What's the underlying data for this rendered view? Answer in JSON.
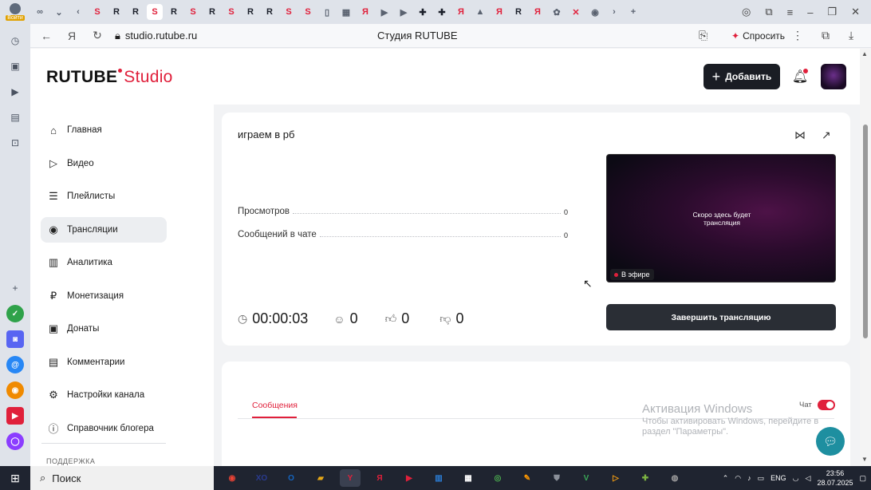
{
  "browser": {
    "profile_label": "Войти",
    "tabs": [
      {
        "glyph": "∞",
        "kind": "grey"
      },
      {
        "glyph": "⌄",
        "kind": "grey"
      },
      {
        "glyph": "‹",
        "kind": "grey"
      },
      {
        "glyph": "S",
        "kind": "s"
      },
      {
        "glyph": "R",
        "kind": "r"
      },
      {
        "glyph": "R",
        "kind": "r"
      },
      {
        "glyph": "S",
        "kind": "s",
        "active": true
      },
      {
        "glyph": "R",
        "kind": "r"
      },
      {
        "glyph": "S",
        "kind": "s"
      },
      {
        "glyph": "R",
        "kind": "r"
      },
      {
        "glyph": "S",
        "kind": "s"
      },
      {
        "glyph": "R",
        "kind": "r"
      },
      {
        "glyph": "R",
        "kind": "r"
      },
      {
        "glyph": "S",
        "kind": "s"
      },
      {
        "glyph": "S",
        "kind": "s"
      },
      {
        "glyph": "▯",
        "kind": "grey"
      },
      {
        "glyph": "▦",
        "kind": "grey"
      },
      {
        "glyph": "Я",
        "kind": "y"
      },
      {
        "glyph": "▶",
        "kind": "grey"
      },
      {
        "glyph": "▶",
        "kind": "grey"
      },
      {
        "glyph": "✚",
        "kind": "r"
      },
      {
        "glyph": "✚",
        "kind": "r"
      },
      {
        "glyph": "Я",
        "kind": "y"
      },
      {
        "glyph": "▲",
        "kind": "grey"
      },
      {
        "glyph": "Я",
        "kind": "y"
      },
      {
        "glyph": "R",
        "kind": "r"
      },
      {
        "glyph": "Я",
        "kind": "y"
      },
      {
        "glyph": "✿",
        "kind": "grey"
      },
      {
        "glyph": "✕",
        "kind": "y"
      },
      {
        "glyph": "◉",
        "kind": "grey"
      },
      {
        "glyph": "›",
        "kind": "grey"
      },
      {
        "glyph": "+",
        "kind": "grey"
      }
    ],
    "url": "studio.rutube.ru",
    "page_title": "Студия RUTUBE",
    "ask_label": "Спросить"
  },
  "studio": {
    "logo_main": "RUTUBE",
    "logo_accent": "Studio",
    "add_label": "Добавить",
    "nav": [
      {
        "id": "home",
        "label": "Главная",
        "icon": "⌂"
      },
      {
        "id": "video",
        "label": "Видео",
        "icon": "▷"
      },
      {
        "id": "playlists",
        "label": "Плейлисты",
        "icon": "☰"
      },
      {
        "id": "streams",
        "label": "Трансляции",
        "icon": "◉",
        "active": true
      },
      {
        "id": "analytics",
        "label": "Аналитика",
        "icon": "▥"
      },
      {
        "id": "monetization",
        "label": "Монетизация",
        "icon": "₽"
      },
      {
        "id": "donations",
        "label": "Донаты",
        "icon": "▣"
      },
      {
        "id": "comments",
        "label": "Комментарии",
        "icon": "▤"
      },
      {
        "id": "channel-settings",
        "label": "Настройки канала",
        "icon": "⚙"
      },
      {
        "id": "blogger-guide",
        "label": "Справочник блогера",
        "icon": "ⓘ"
      }
    ],
    "support_label": "ПОДДЕРЖКА"
  },
  "stream": {
    "title": "играем в рб",
    "stats": [
      {
        "label": "Просмотров",
        "value": "0"
      },
      {
        "label": "Сообщений в чате",
        "value": "0"
      }
    ],
    "preview_text_1": "Скоро здесь будет",
    "preview_text_2": "трансляция",
    "live_label": "В эфире",
    "end_label": "Завершить трансляцию",
    "duration": "00:00:03",
    "viewers": "0",
    "likes": "0",
    "dislikes": "0"
  },
  "chat": {
    "tab_messages": "Сообщения",
    "chat_toggle_label": "Чат",
    "chat_enabled": true
  },
  "watermark": {
    "line1": "Активация Windows",
    "line2": "Чтобы активировать Windows, перейдите в",
    "line3": "раздел \"Параметры\"."
  },
  "taskbar": {
    "search_label": "Поиск",
    "apps": [
      "◉",
      "XO",
      "O",
      "▰",
      "Y",
      "Я",
      "▶",
      "▥",
      "▦",
      "◎",
      "✎",
      "⛊",
      "V",
      "▷",
      "✚",
      "◍"
    ],
    "active_app_index": 4,
    "lang": "ENG",
    "time": "23:56",
    "date": "28.07.2025"
  }
}
